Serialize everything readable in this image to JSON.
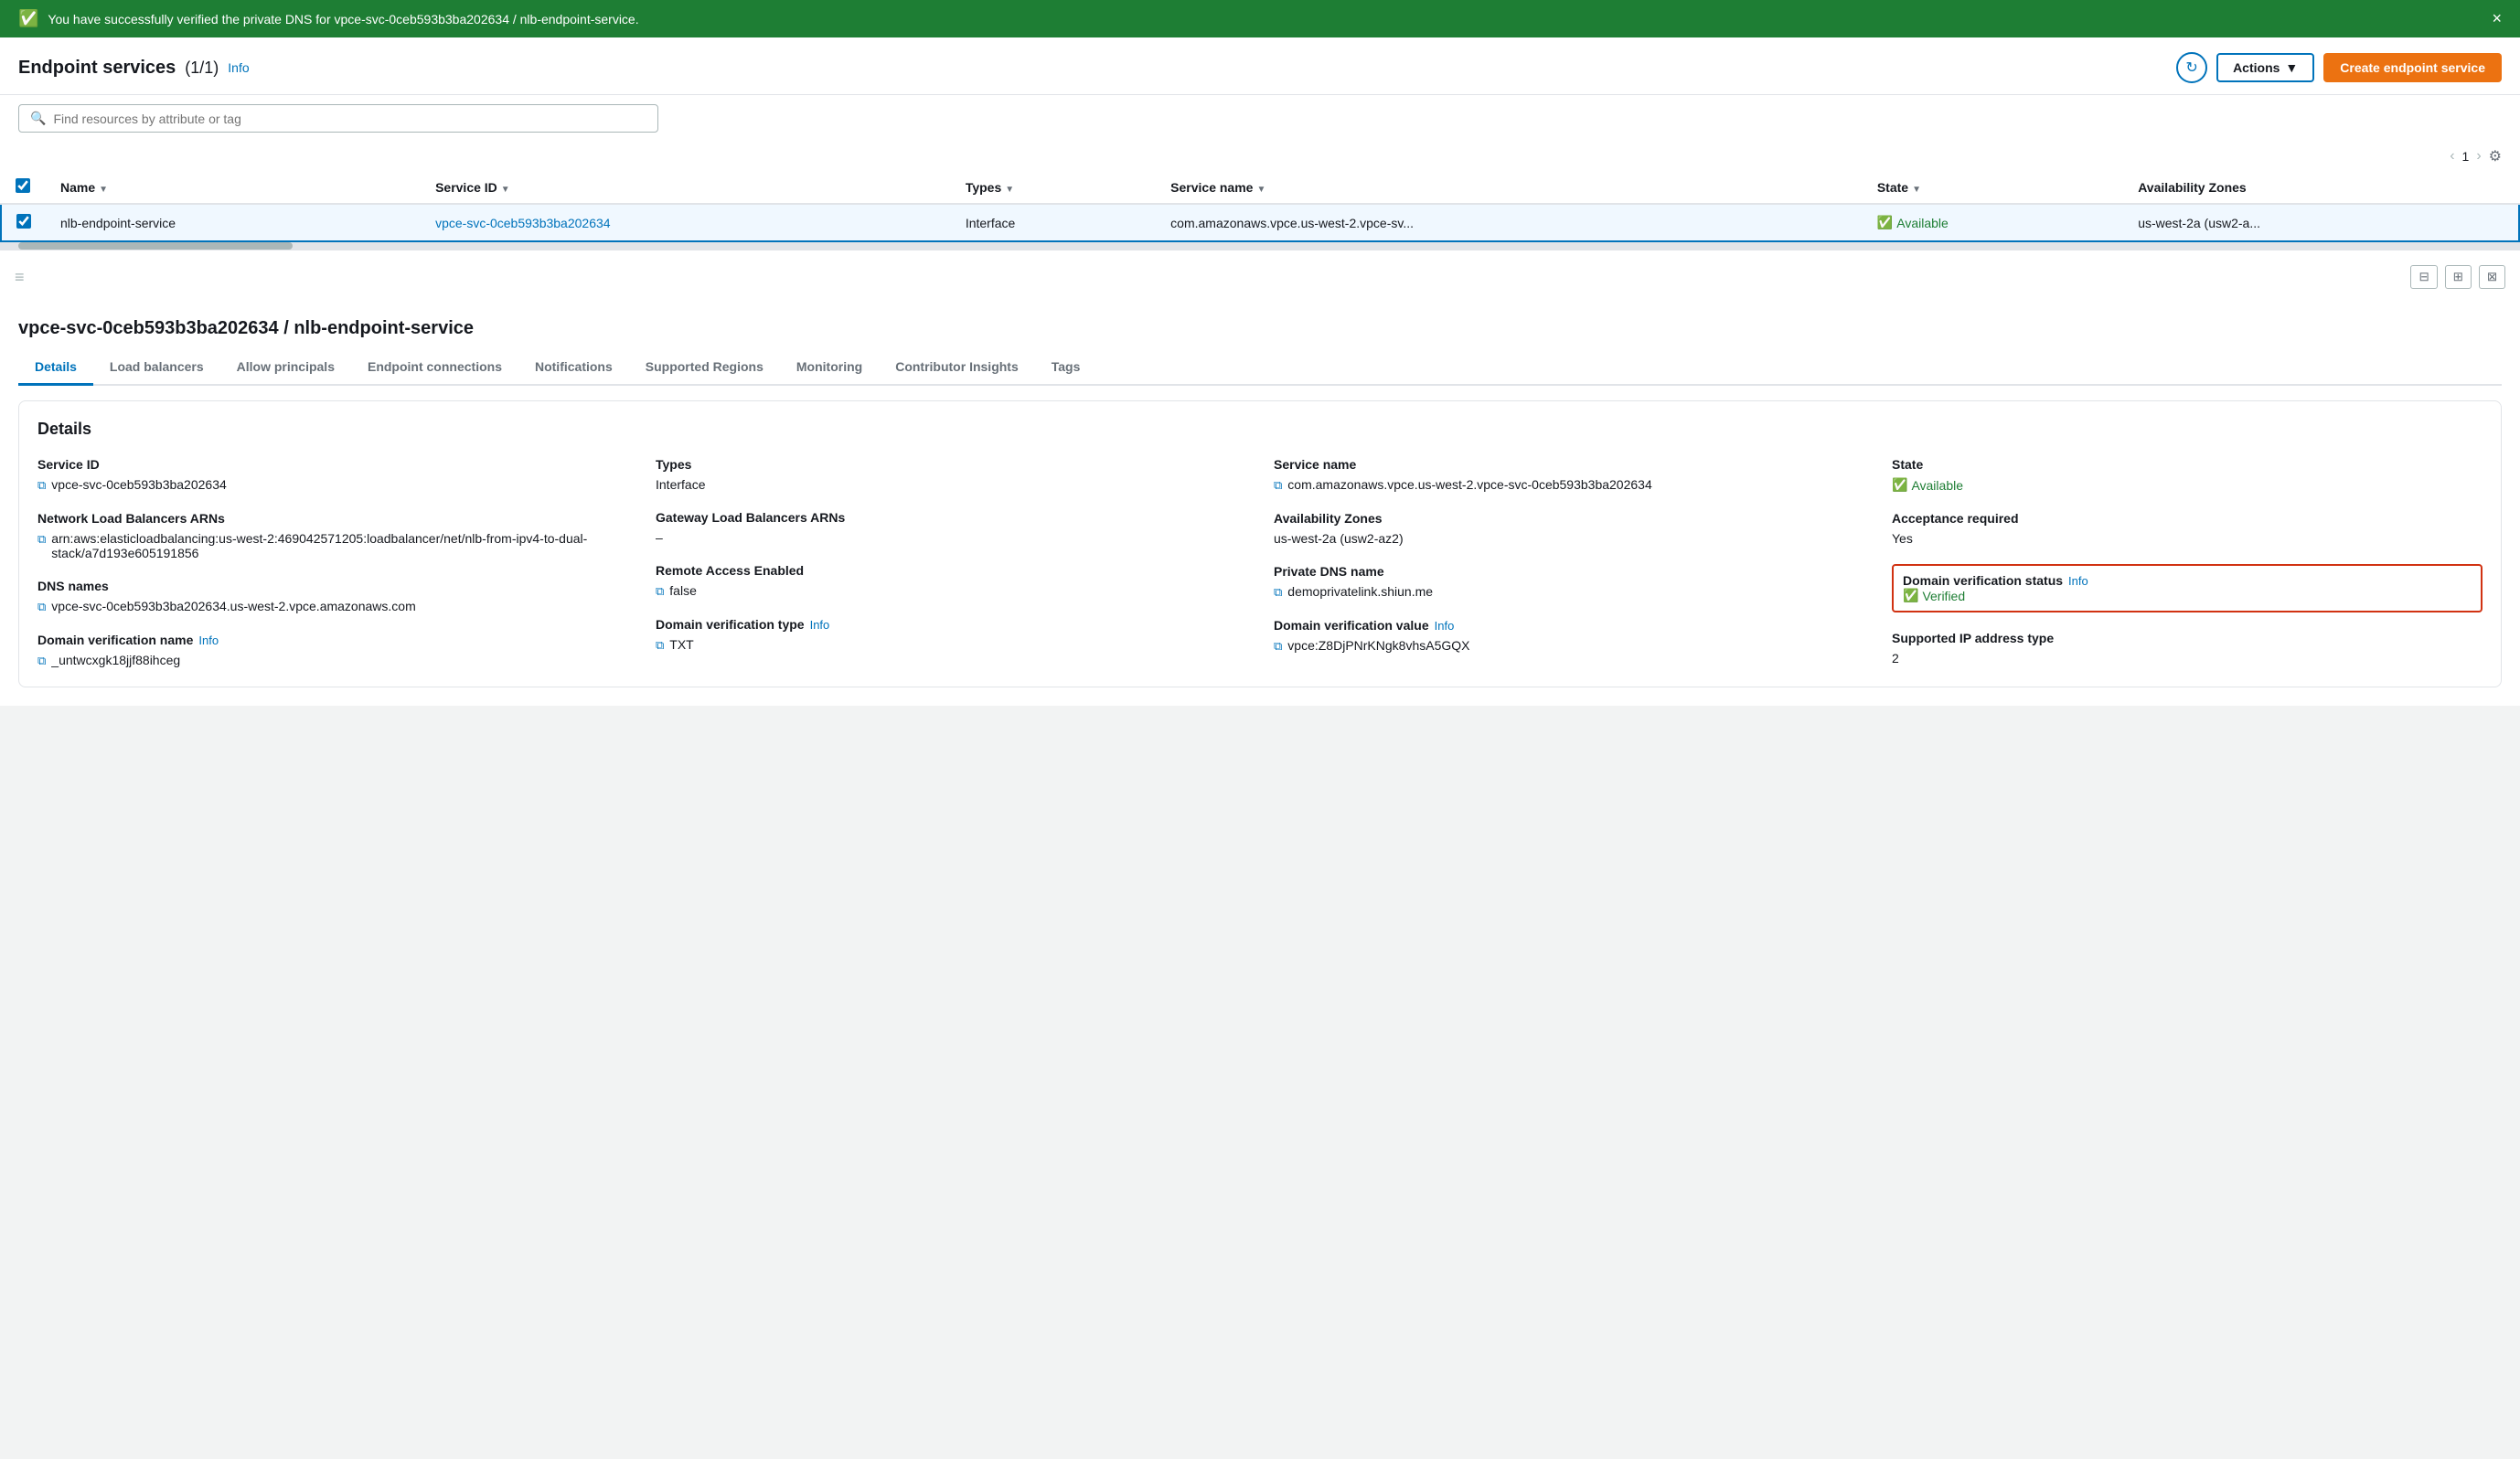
{
  "banner": {
    "message": "You have successfully verified the private DNS for vpce-svc-0ceb593b3ba202634 / nlb-endpoint-service.",
    "close_label": "×"
  },
  "header": {
    "title": "Endpoint services",
    "count": "(1/1)",
    "info_label": "Info",
    "refresh_icon": "↻",
    "actions_label": "Actions",
    "create_label": "Create endpoint service"
  },
  "search": {
    "placeholder": "Find resources by attribute or tag"
  },
  "pagination": {
    "prev_icon": "‹",
    "next_icon": "›",
    "current_page": "1",
    "settings_icon": "⚙"
  },
  "table": {
    "columns": [
      {
        "label": "Name"
      },
      {
        "label": "Service ID"
      },
      {
        "label": "Types"
      },
      {
        "label": "Service name"
      },
      {
        "label": "State"
      },
      {
        "label": "Availability Zones"
      }
    ],
    "rows": [
      {
        "name": "nlb-endpoint-service",
        "service_id": "vpce-svc-0ceb593b3ba202634",
        "types": "Interface",
        "service_name": "com.amazonaws.vpce.us-west-2.vpce-sv...",
        "state": "Available",
        "availability_zones": "us-west-2a (usw2-a..."
      }
    ]
  },
  "detail_header": {
    "title": "vpce-svc-0ceb593b3ba202634 / nlb-endpoint-service"
  },
  "tabs": [
    {
      "label": "Details",
      "active": true
    },
    {
      "label": "Load balancers"
    },
    {
      "label": "Allow principals"
    },
    {
      "label": "Endpoint connections"
    },
    {
      "label": "Notifications"
    },
    {
      "label": "Supported Regions"
    },
    {
      "label": "Monitoring"
    },
    {
      "label": "Contributor Insights"
    },
    {
      "label": "Tags"
    }
  ],
  "details_card": {
    "title": "Details",
    "fields": {
      "service_id": {
        "label": "Service ID",
        "value": "vpce-svc-0ceb593b3ba202634"
      },
      "network_lb_arns": {
        "label": "Network Load Balancers ARNs",
        "value": "arn:aws:elasticloadbalancing:us-west-2:469042571205:loadbalancer/net/nlb-from-ipv4-to-dual-stack/a7d193e605191856"
      },
      "dns_names": {
        "label": "DNS names",
        "value": "vpce-svc-0ceb593b3ba202634.us-west-2.vpce.amazonaws.com"
      },
      "domain_verification_name": {
        "label": "Domain verification name",
        "info_label": "Info",
        "value": "_untwcxgk18jjf88ihceg"
      },
      "types": {
        "label": "Types",
        "value": "Interface"
      },
      "gateway_lb_arns": {
        "label": "Gateway Load Balancers ARNs",
        "value": "–"
      },
      "remote_access_enabled": {
        "label": "Remote Access Enabled",
        "value": "false"
      },
      "domain_verification_type": {
        "label": "Domain verification type",
        "info_label": "Info",
        "value": "TXT"
      },
      "service_name": {
        "label": "Service name",
        "value": "com.amazonaws.vpce.us-west-2.vpce-svc-0ceb593b3ba202634"
      },
      "availability_zones": {
        "label": "Availability Zones",
        "value": "us-west-2a (usw2-az2)"
      },
      "private_dns_name": {
        "label": "Private DNS name",
        "value": "demoprivatelink.shiun.me"
      },
      "domain_verification_value": {
        "label": "Domain verification value",
        "info_label": "Info",
        "value": "vpce:Z8DjPNrKNgk8vhsA5GQX"
      },
      "state": {
        "label": "State",
        "value": "Available"
      },
      "acceptance_required": {
        "label": "Acceptance required",
        "value": "Yes"
      },
      "domain_verification_status": {
        "label": "Domain verification status",
        "info_label": "Info",
        "value": "Verified"
      },
      "supported_ip_address_type": {
        "label": "Supported IP address type",
        "value": "2"
      }
    }
  }
}
